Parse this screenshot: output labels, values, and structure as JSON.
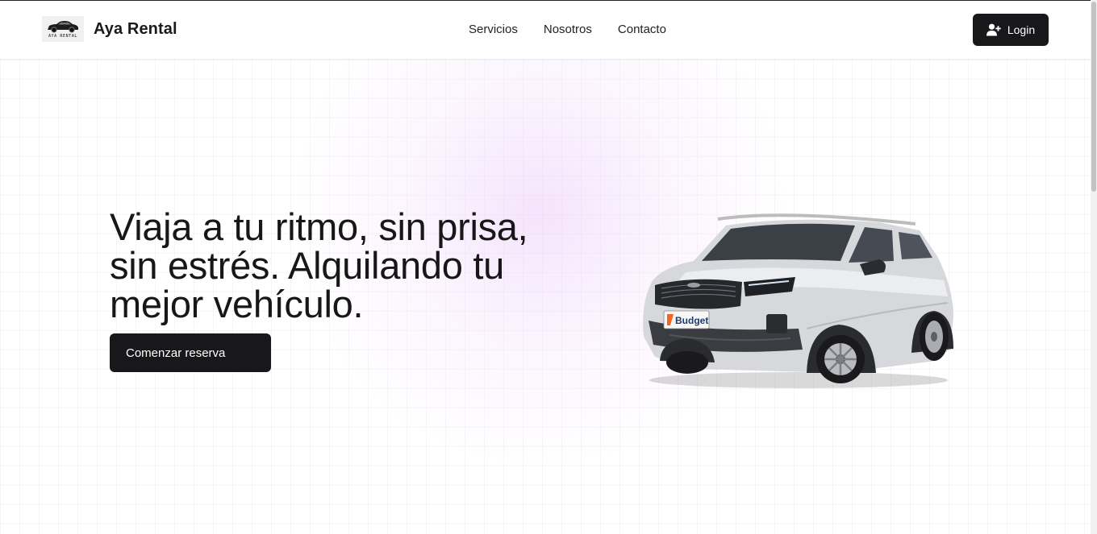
{
  "header": {
    "brand_name": "Aya Rental",
    "logo_caption": "AYA RENTAL",
    "nav": [
      {
        "label": "Servicios"
      },
      {
        "label": "Nosotros"
      },
      {
        "label": "Contacto"
      }
    ],
    "login_label": "Login"
  },
  "hero": {
    "headline": "Viaja a tu ritmo, sin prisa, sin estrés. Alquilando tu mejor vehículo.",
    "cta_label": "Comenzar reserva",
    "car_badge": "Budget"
  },
  "colors": {
    "primary_dark": "#18181b",
    "text": "#171717",
    "glow": "#f3dcfb",
    "budget_orange": "#f26522"
  },
  "icons": {
    "login": "user-plus-icon"
  }
}
